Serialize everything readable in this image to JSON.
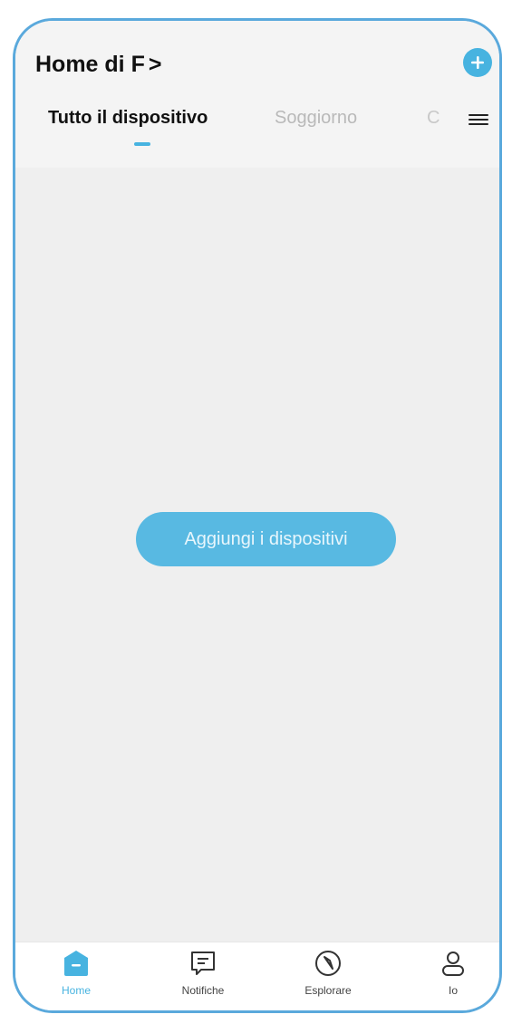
{
  "header": {
    "title": "Home di F",
    "title_chevron": ">",
    "add_icon": "plus-circle-icon"
  },
  "tabs": [
    {
      "label": "Tutto il dispositivo",
      "active": true
    },
    {
      "label": "Soggiorno",
      "active": false
    },
    {
      "label": "C",
      "active": false
    }
  ],
  "tabs_menu_icon": "hamburger-menu-icon",
  "main": {
    "add_devices_label": "Aggiungi i dispositivi"
  },
  "bottom_nav": [
    {
      "label": "Home",
      "icon": "home-icon",
      "active": true
    },
    {
      "label": "Notifiche",
      "icon": "message-icon",
      "active": false
    },
    {
      "label": "Esplorare",
      "icon": "compass-icon",
      "active": false
    },
    {
      "label": "Io",
      "icon": "user-icon",
      "active": false
    }
  ],
  "colors": {
    "accent": "#47b3e0",
    "background": "#efefef",
    "frame": "#5aa9dc"
  }
}
